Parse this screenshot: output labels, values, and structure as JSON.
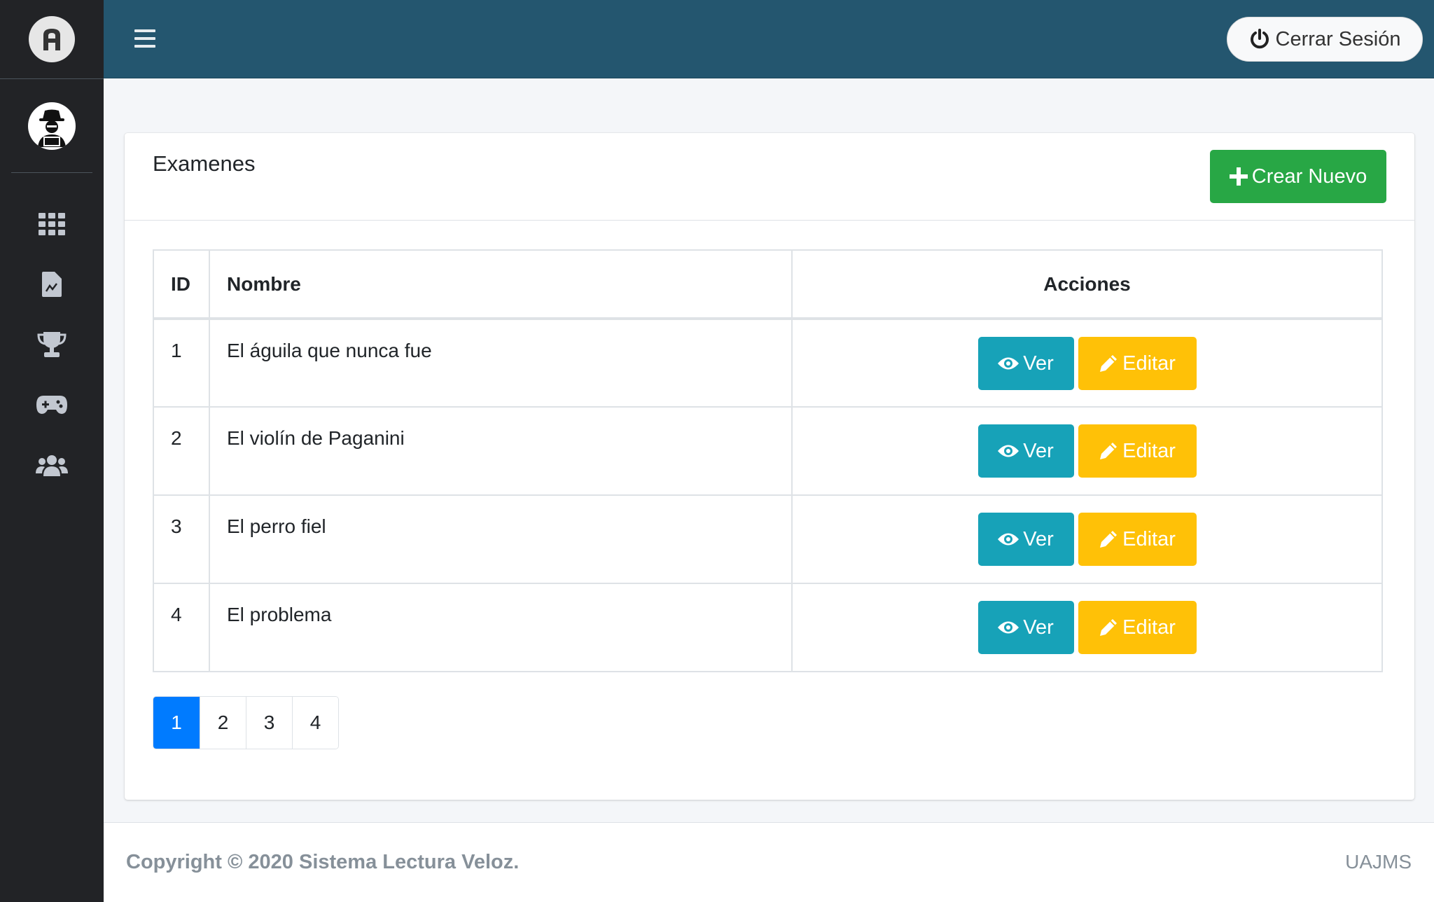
{
  "header": {
    "logout_label": "Cerrar Sesión"
  },
  "sidebar": {
    "nav_items": [
      {
        "icon": "grid-icon"
      },
      {
        "icon": "document-chart-icon"
      },
      {
        "icon": "trophy-icon"
      },
      {
        "icon": "gamepad-icon"
      },
      {
        "icon": "users-icon"
      }
    ]
  },
  "card": {
    "title": "Examenes",
    "create_label": "Crear Nuevo"
  },
  "table": {
    "headers": [
      "ID",
      "Nombre",
      "Acciones"
    ],
    "rows": [
      {
        "id": "1",
        "name": "El águila que nunca fue"
      },
      {
        "id": "2",
        "name": "El violín de Paganini"
      },
      {
        "id": "3",
        "name": "El perro fiel"
      },
      {
        "id": "4",
        "name": "El problema"
      }
    ],
    "view_label": "Ver",
    "edit_label": "Editar"
  },
  "pagination": {
    "pages": [
      "1",
      "2",
      "3",
      "4"
    ],
    "active": "1"
  },
  "footer": {
    "copyright": "Copyright © 2020 Sistema Lectura Veloz.",
    "right": "UAJMS"
  },
  "colors": {
    "topbar": "#24566f",
    "sidebar": "#222326",
    "create": "#28a745",
    "view": "#17a2b8",
    "edit": "#ffc107",
    "active_page": "#007bff"
  }
}
